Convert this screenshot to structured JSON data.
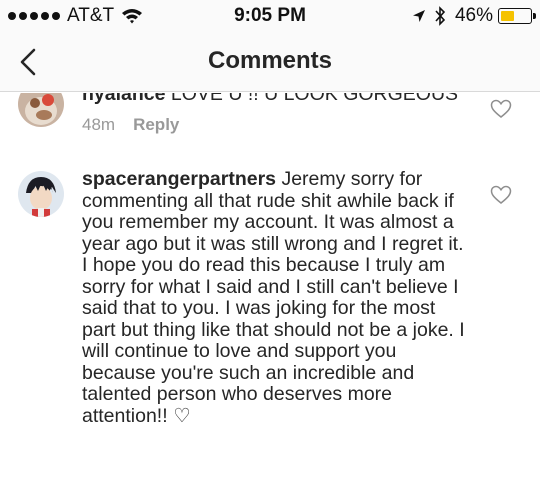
{
  "status_bar": {
    "carrier": "AT&T",
    "time": "9:05 PM",
    "battery_percent": "46%",
    "battery_level": 0.46,
    "battery_color": "#f5c200"
  },
  "nav": {
    "title": "Comments",
    "back_icon": "chevron-left-icon"
  },
  "comments": [
    {
      "username": "nyalance",
      "text": "LOVE U !! U LOOK GORGEOUS",
      "time": "48m",
      "reply_label": "Reply",
      "like_icon": "heart-outline-icon"
    },
    {
      "username": "spacerangerpartners",
      "text": "Jeremy sorry for commenting all that rude shit awhile back if you remember my account. It was almost a year ago but it was still wrong and I regret it. I hope you do read this because I truly am sorry for what I said and I still can't believe I said that to you. I was joking for the most part but thing like that should not be a joke. I will continue to love and support you because you're such an incredible and talented person who deserves more attention!! ♡",
      "like_icon": "heart-outline-icon"
    }
  ]
}
